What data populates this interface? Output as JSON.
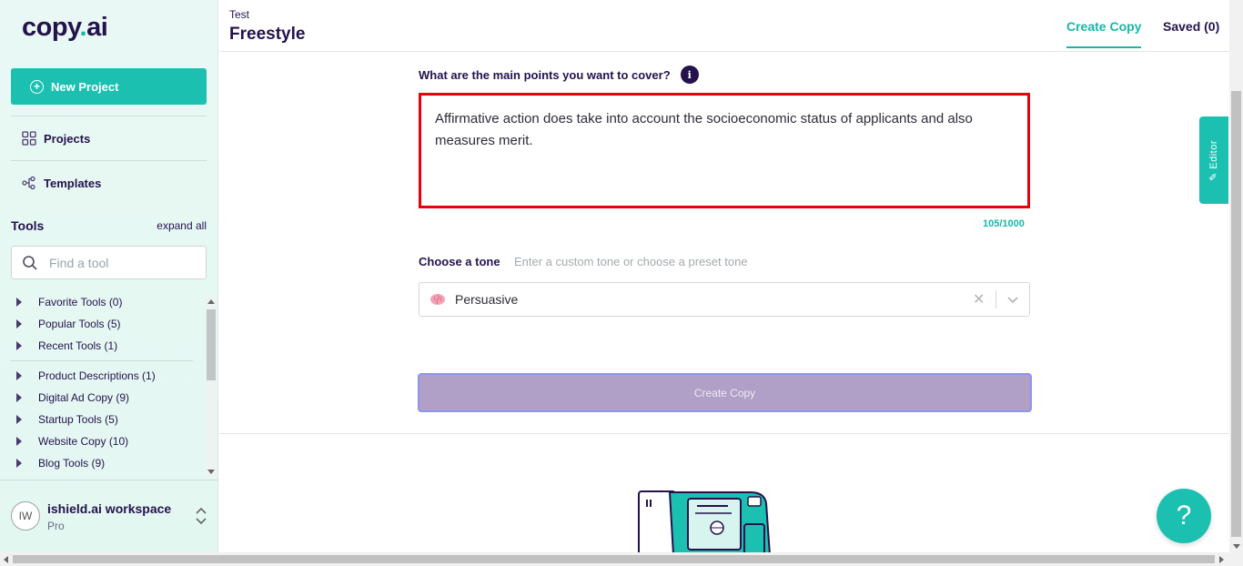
{
  "brand": {
    "name_main": "copy",
    "name_dot": ".",
    "name_tld": "ai",
    "accent": "#1cc0b1",
    "primary_dark": "#24124d",
    "highlight_border": "#e8000b"
  },
  "sidebar": {
    "new_project_label": "New Project",
    "nav": [
      {
        "label": "Projects",
        "icon": "grid-icon"
      },
      {
        "label": "Templates",
        "icon": "templates-icon"
      }
    ],
    "tools_title": "Tools",
    "expand_all_label": "expand all",
    "search_placeholder": "Find a tool",
    "tool_groups": [
      {
        "label": "Favorite Tools (0)"
      },
      {
        "label": "Popular Tools (5)"
      },
      {
        "label": "Recent Tools (1)"
      },
      {
        "label": "Product Descriptions (1)"
      },
      {
        "label": "Digital Ad Copy (9)"
      },
      {
        "label": "Startup Tools (5)"
      },
      {
        "label": "Website Copy (10)"
      },
      {
        "label": "Blog Tools (9)"
      }
    ],
    "workspace": {
      "initials": "IW",
      "name": "ishield.ai workspace",
      "plan": "Pro"
    }
  },
  "header": {
    "breadcrumb": "Test",
    "title": "Freestyle",
    "tabs": [
      {
        "label": "Create Copy",
        "active": true
      },
      {
        "label": "Saved (0)",
        "active": false
      }
    ]
  },
  "form": {
    "points_label": "What are the main points you want to cover?",
    "info_icon": "i",
    "points_value": "Affirmative action does take into account the socioeconomic status of applicants and also measures merit.",
    "char_count": "105/1000",
    "tone_label": "Choose a tone",
    "tone_hint": "Enter a custom tone or choose a preset tone",
    "tone_value": "Persuasive",
    "tone_icon": "brain-icon",
    "clear_icon": "✕",
    "create_button": "Create Copy"
  },
  "side_tab": {
    "label": "Editor"
  },
  "help": {
    "label": "?"
  }
}
